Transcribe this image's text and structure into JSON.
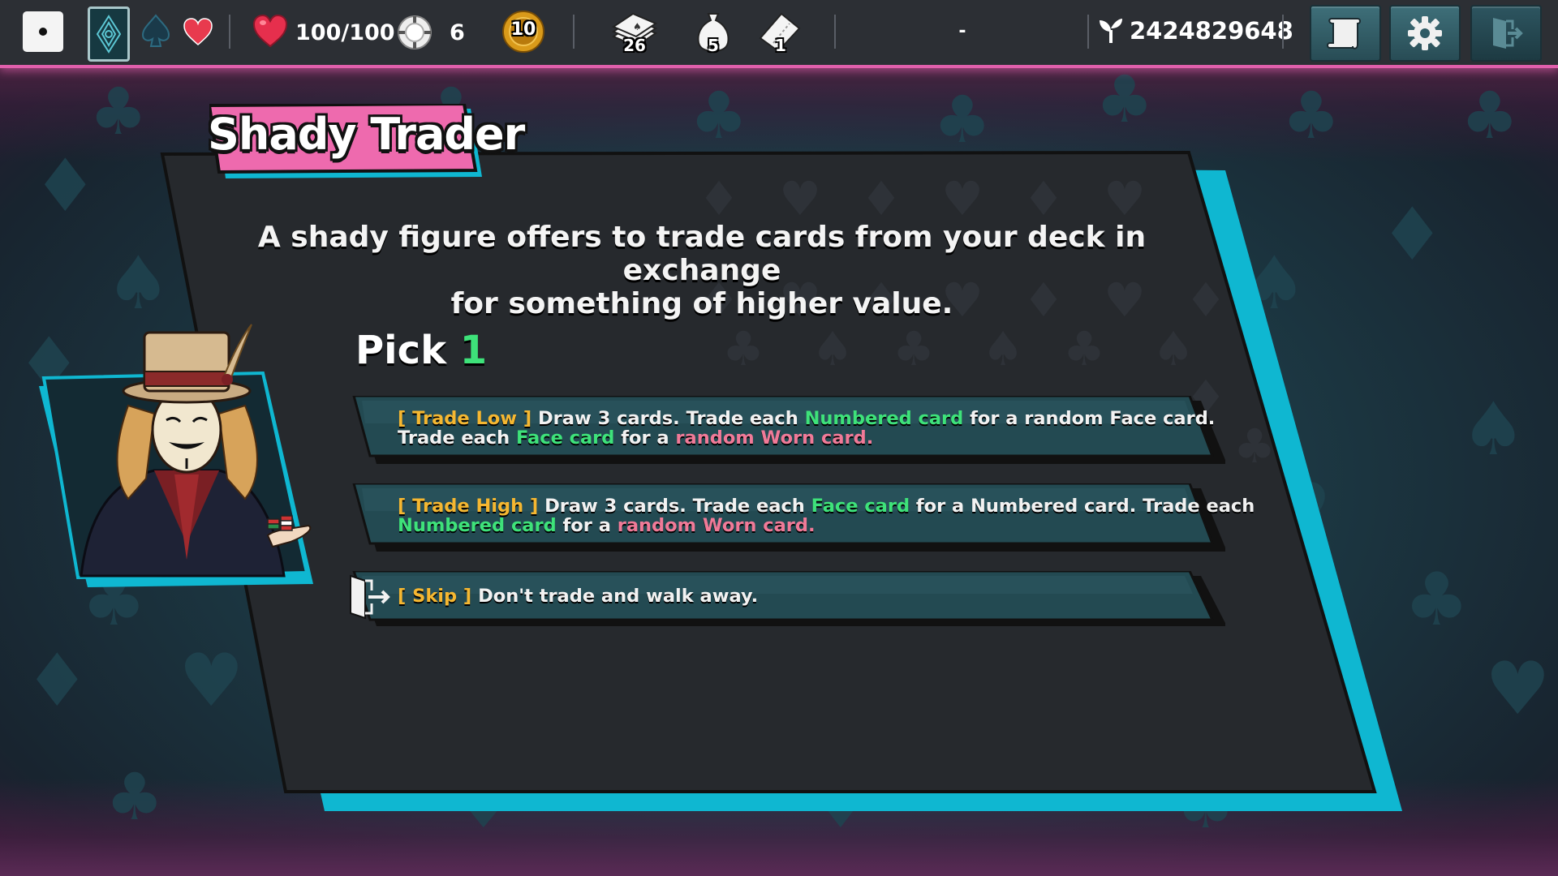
{
  "topbar": {
    "health": "100/100",
    "chips": "6",
    "coin": "10",
    "deck_count": "26",
    "bag_count": "5",
    "ticket_count": "1",
    "middle_value": "-",
    "seed": "2424829648",
    "icons": [
      "dice-icon",
      "card-back-icon",
      "spade-icon",
      "heart-suit-icon",
      "health-heart-icon",
      "poker-chip-icon",
      "gold-coin-icon",
      "deck-icon",
      "bag-icon",
      "ticket-icon",
      "seed-sprout-icon",
      "scroll-icon",
      "gear-icon",
      "exit-door-icon"
    ]
  },
  "event": {
    "title": "Shady Trader",
    "description_line1": "A shady figure offers to trade cards from your deck in exchange",
    "description_line2": "for something of higher value.",
    "pick_label": "Pick",
    "pick_count": "1"
  },
  "options": [
    {
      "tag": "[ Trade Low ]",
      "l1_a": " Draw 3 cards. Trade each ",
      "l1_b": "Numbered card",
      "l1_c": " for a random Face card.",
      "l2_a": "Trade each ",
      "l2_b": "Face card",
      "l2_c": " for a ",
      "l2_d": "random Worn card."
    },
    {
      "tag": "[ Trade High ]",
      "l1_a": " Draw 3 cards. Trade each ",
      "l1_b": "Face card",
      "l1_c": " for a Numbered card. Trade each",
      "l2_b": "Numbered card",
      "l2_c": " for a ",
      "l2_d": "random Worn card."
    },
    {
      "tag": "[ Skip ]",
      "text": " Don't trade and walk away."
    }
  ],
  "colors": {
    "accent_pink": "#e05fab",
    "accent_cyan": "#0fb7d1",
    "highlight_yellow": "#f5b731",
    "highlight_green": "#3ee27a",
    "highlight_red": "#f07a98",
    "panel": "#26292d"
  }
}
